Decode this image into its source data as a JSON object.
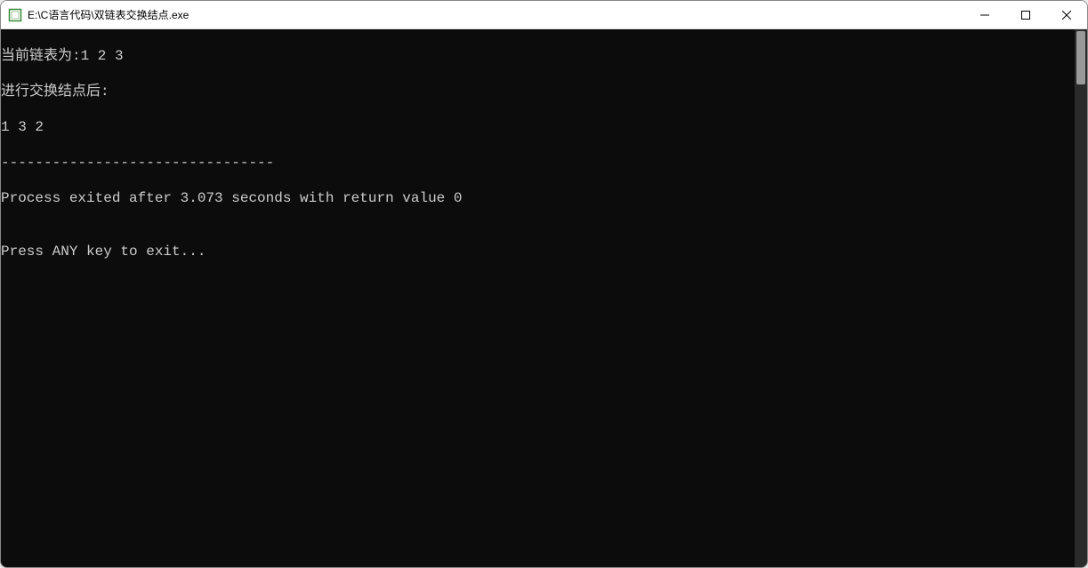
{
  "window": {
    "title": "E:\\C语言代码\\双链表交换结点.exe"
  },
  "terminal": {
    "lines": {
      "l0": "当前链表为:1 2 3",
      "l1": "进行交换结点后:",
      "l2": "1 3 2",
      "l3": "--------------------------------",
      "l4": "Process exited after 3.073 seconds with return value 0",
      "l5": "",
      "l6": "Press ANY key to exit..."
    }
  }
}
